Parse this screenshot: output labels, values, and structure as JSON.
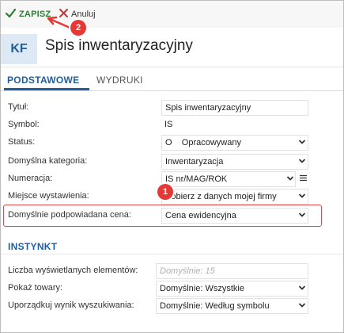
{
  "toolbar": {
    "save_label": "ZAPISZ",
    "cancel_label": "Anuluj"
  },
  "header": {
    "avatar": "KF",
    "title": "Spis inwentaryzacyjny"
  },
  "tabs": [
    {
      "label": "PODSTAWOWE"
    },
    {
      "label": "WYDRUKI"
    }
  ],
  "form": {
    "rows": [
      {
        "label": "Tytuł:",
        "value": "Spis inwentaryzacyjny"
      },
      {
        "label": "Symbol:",
        "value": "IS"
      },
      {
        "label": "Status:",
        "value": "O    Opracowywany"
      },
      {
        "label": "Domyślna kategoria:",
        "value": "Inwentaryzacja"
      },
      {
        "label": "Numeracja:",
        "value": "IS nr/MAG/ROK"
      },
      {
        "label": "Miejsce wystawienia:",
        "value": "Pobierz z danych mojej firmy"
      },
      {
        "label": "Domyślnie podpowiadana cena:",
        "value": "Cena ewidencyjna"
      }
    ]
  },
  "section": {
    "title": "INSTYNKT",
    "rows": [
      {
        "label": "Liczba wyświetlanych elementów:",
        "placeholder": "Domyślnie: 15"
      },
      {
        "label": "Pokaż towary:",
        "value": "Domyślnie: Wszystkie"
      },
      {
        "label": "Uporządkuj wynik wyszukiwania:",
        "value": "Domyślnie: Według symbolu"
      }
    ]
  },
  "annotations": {
    "badge_1": "1",
    "badge_2": "2"
  },
  "colors": {
    "accent": "#1f5f9e",
    "save_green": "#2e7d32",
    "highlight_red": "#e24b4b"
  }
}
